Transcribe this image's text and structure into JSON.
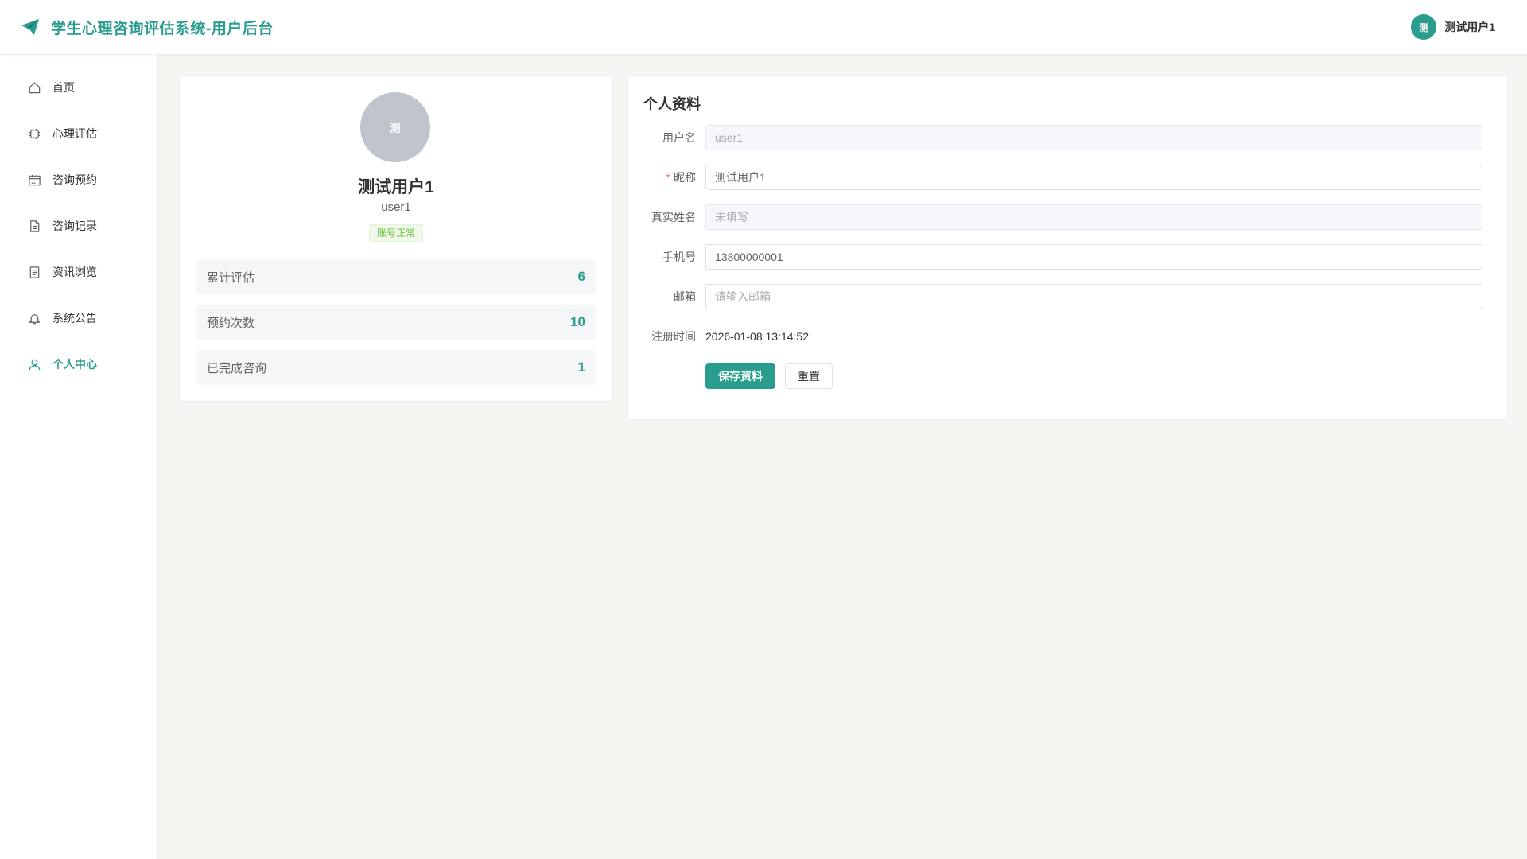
{
  "header": {
    "title": "学生心理咨询评估系统-用户后台",
    "user_avatar_text": "测",
    "user_name": "测试用户1",
    "brand_icon": "paper-plane-icon"
  },
  "sidebar": {
    "items": [
      {
        "label": "首页",
        "icon": "home-icon"
      },
      {
        "label": "心理评估",
        "icon": "chip-icon"
      },
      {
        "label": "咨询预约",
        "icon": "calendar-icon"
      },
      {
        "label": "咨询记录",
        "icon": "document-icon"
      },
      {
        "label": "资讯浏览",
        "icon": "notes-icon"
      },
      {
        "label": "系统公告",
        "icon": "bell-icon"
      },
      {
        "label": "个人中心",
        "icon": "user-icon",
        "active": true
      }
    ]
  },
  "profile": {
    "avatar_text": "测",
    "nickname": "测试用户1",
    "username": "user1",
    "status": "账号正常",
    "stats": [
      {
        "label": "累计评估",
        "value": "6"
      },
      {
        "label": "预约次数",
        "value": "10"
      },
      {
        "label": "已完成咨询",
        "value": "1"
      }
    ]
  },
  "form": {
    "title": "个人资料",
    "username_label": "用户名",
    "username_value": "user1",
    "nickname_label": "昵称",
    "nickname_required": "*",
    "nickname_value": "测试用户1",
    "realname_label": "真实姓名",
    "realname_placeholder": "未填写",
    "phone_label": "手机号",
    "phone_value": "13800000001",
    "email_label": "邮箱",
    "email_placeholder": "请输入邮箱",
    "regtime_label": "注册时间",
    "regtime_value": "2026-01-08 13:14:52",
    "save_label": "保存资料",
    "reset_label": "重置"
  },
  "colors": {
    "accent": "#2a9d8f",
    "background": "#f7f5f2",
    "status_green": "#67c23a",
    "required_red": "#f56c6c"
  }
}
